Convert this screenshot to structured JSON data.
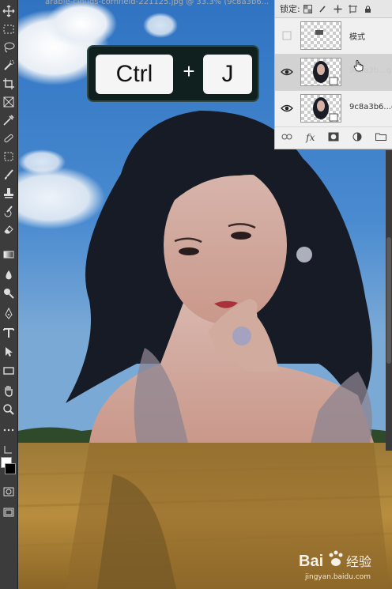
{
  "document": {
    "tab_title": "arable-clouds-cornfield-221125.jpg @ 33.3% (9c8a3b6...",
    "scene": "woman-over-field-double-exposure"
  },
  "shortcut": {
    "key1": "Ctrl",
    "plus": "+",
    "key2": "J"
  },
  "layers_panel": {
    "lock_label": "锁定:",
    "layers": [
      {
        "name": "模式",
        "visible": false,
        "thumb": "checker",
        "selected": false
      },
      {
        "name": "9c8a3b...qv",
        "visible": true,
        "thumb": "portrait",
        "selected": true
      },
      {
        "name": "9c8a3b6...g",
        "visible": true,
        "thumb": "portrait",
        "selected": false
      }
    ],
    "bottom_icons": [
      "link-icon",
      "fx-icon",
      "mask-icon",
      "adjustment-icon",
      "group-icon"
    ]
  },
  "tools": [
    "move-icon",
    "marquee-icon",
    "lasso-icon",
    "quick-select-icon",
    "crop-icon",
    "frame-icon",
    "eyedropper-icon",
    "heal-icon",
    "brush-icon",
    "stamp-icon",
    "history-brush-icon",
    "eraser-icon",
    "gradient-icon",
    "blur-icon",
    "dodge-icon",
    "pen-icon",
    "type-icon",
    "path-select-icon",
    "shape-icon",
    "hand-icon",
    "zoom-icon",
    "more-icon"
  ],
  "watermark": {
    "brand": "Bai",
    "cn": "经验",
    "url": "jingyan.baidu.com"
  },
  "colors": {
    "overlay_bg": "#10201f",
    "panel_bg": "#f0f0f0",
    "toolbar_bg": "#3c3c3c"
  }
}
